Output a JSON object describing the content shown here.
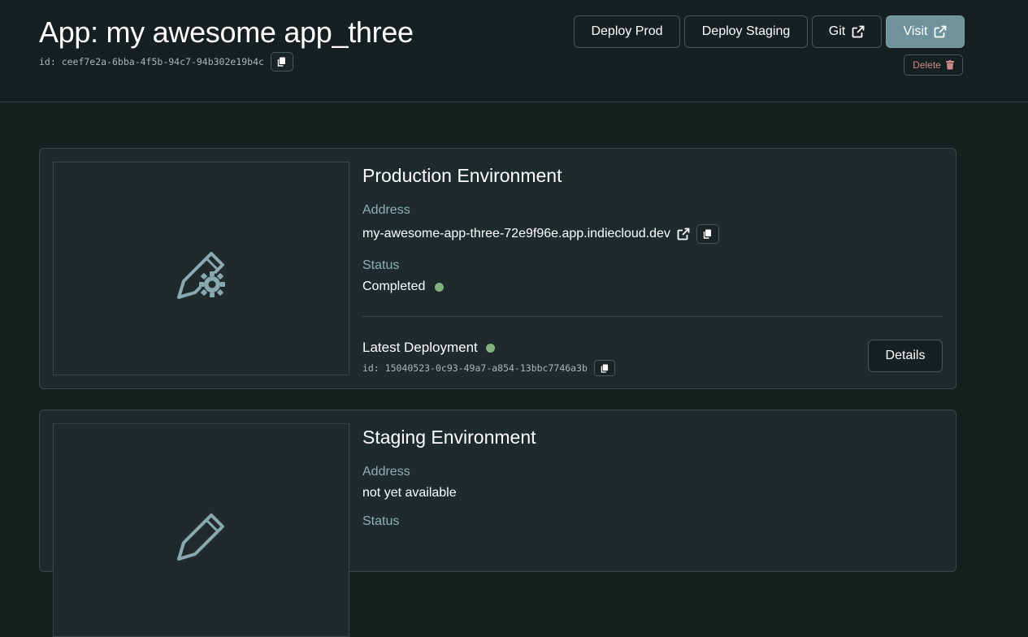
{
  "app": {
    "title": "App: my awesome app_three",
    "id_text": "id: ceef7e2a-6bba-4f5b-94c7-94b302e19b4c"
  },
  "actions": {
    "deploy_prod": "Deploy Prod",
    "deploy_staging": "Deploy Staging",
    "git": "Git",
    "visit": "Visit",
    "delete": "Delete"
  },
  "production": {
    "title": "Production Environment",
    "address_label": "Address",
    "address": "my-awesome-app-three-72e9f96e.app.indiecloud.dev",
    "status_label": "Status",
    "status": "Completed",
    "latest_label": "Latest Deployment",
    "deployment_id_text": "id: 15040523-0c93-49a7-a854-13bbc7746a3b",
    "details": "Details"
  },
  "staging": {
    "title": "Staging Environment",
    "address_label": "Address",
    "address": "not yet available",
    "status_label": "Status"
  },
  "colors": {
    "background": "#17201f",
    "card": "#1f2a2d",
    "accent": "#6f929c",
    "status_ok": "#7fb27d",
    "label": "#8fb0b6",
    "danger": "#c98a8a"
  },
  "icons": {
    "copy": "copy-icon",
    "external": "external-link-icon",
    "trash": "trash-icon",
    "build": "pencil-gear-icon"
  }
}
